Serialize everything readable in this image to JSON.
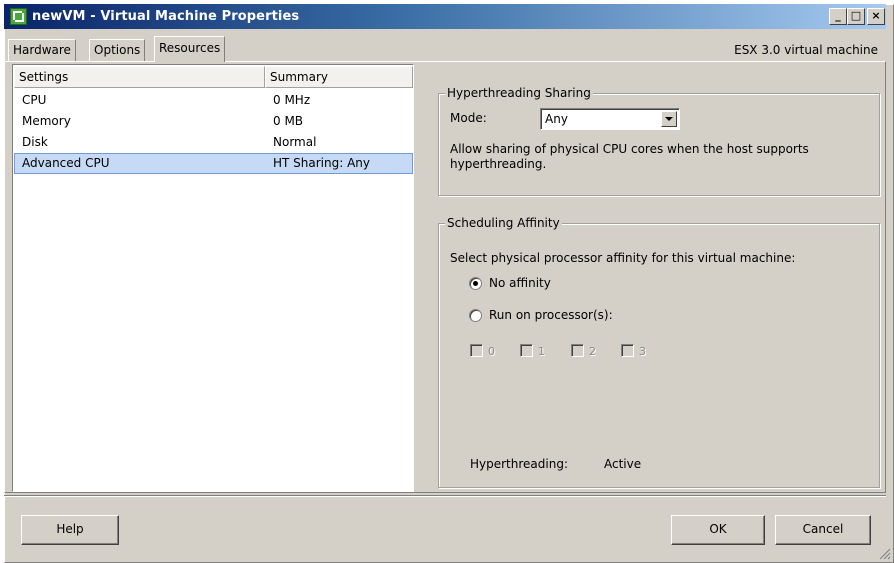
{
  "window": {
    "title": "newVM - Virtual Machine Properties",
    "minimize_glyph": "_",
    "maximize_glyph": "□",
    "close_glyph": "×"
  },
  "tabs": [
    {
      "label": "Hardware",
      "active": false
    },
    {
      "label": "Options",
      "active": false
    },
    {
      "label": "Resources",
      "active": true
    }
  ],
  "vm_version": "ESX 3.0 virtual machine",
  "settings_table": {
    "columns": [
      "Settings",
      "Summary"
    ],
    "rows": [
      {
        "setting": "CPU",
        "summary": "0 MHz",
        "selected": false
      },
      {
        "setting": "Memory",
        "summary": "0 MB",
        "selected": false
      },
      {
        "setting": "Disk",
        "summary": "Normal",
        "selected": false
      },
      {
        "setting": "Advanced CPU",
        "summary": "HT Sharing: Any",
        "selected": true
      }
    ]
  },
  "hyperthreading_sharing": {
    "title": "Hyperthreading Sharing",
    "mode_label": "Mode:",
    "mode_value": "Any",
    "description_line1": "Allow sharing of physical CPU cores when the host supports",
    "description_line2": "hyperthreading."
  },
  "scheduling_affinity": {
    "title": "Scheduling Affinity",
    "prompt": "Select physical processor affinity for this virtual machine:",
    "options": [
      {
        "label": "No affinity",
        "checked": true
      },
      {
        "label": "Run on processor(s):",
        "checked": false
      }
    ],
    "processors": [
      "0",
      "1",
      "2",
      "3"
    ],
    "hyperthreading_label": "Hyperthreading:",
    "hyperthreading_value": "Active"
  },
  "buttons": {
    "help": "Help",
    "ok": "OK",
    "cancel": "Cancel"
  },
  "icons": [
    "vm-app-icon",
    "dropdown-arrow-icon",
    "resize-grip-icon"
  ]
}
